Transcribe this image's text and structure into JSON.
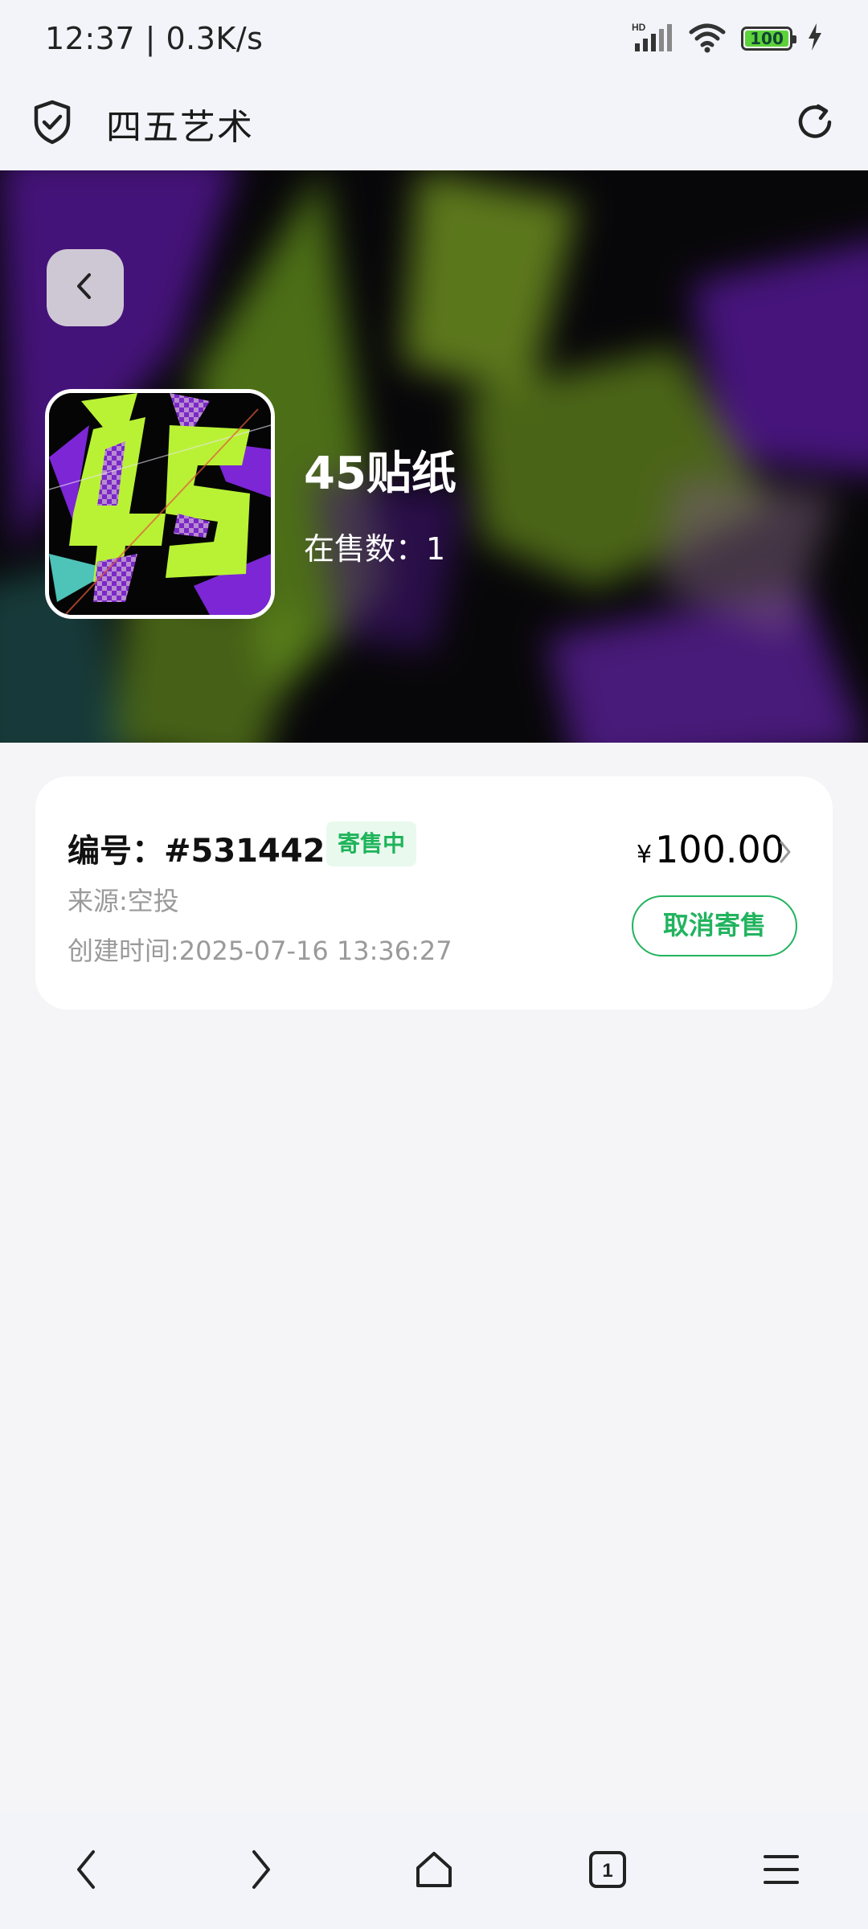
{
  "status_bar": {
    "time": "12:37 | 0.3K/s",
    "network_label": "HD",
    "battery_level": "100",
    "icons": [
      "hd-signal-icon",
      "wifi-icon",
      "battery-icon",
      "charging-icon"
    ]
  },
  "header": {
    "title": "四五艺术",
    "icons": [
      "shield-check-icon",
      "refresh-icon"
    ]
  },
  "hero": {
    "title": "45贴纸",
    "on_sale": "在售数：1",
    "colors": {
      "green": "#a7e22e",
      "purple": "#7a1fd1",
      "black": "#0b0a0d"
    }
  },
  "listing": {
    "id": "编号：#5314426",
    "status": "寄售中",
    "source": "来源:空投",
    "created": "创建时间:2025-07-16 13:36:27",
    "currency": "¥",
    "price": "100.00",
    "cancel_label": "取消寄售",
    "accent": "#22b35e"
  },
  "bottom_nav": {
    "tab_count": "1",
    "icons": [
      "back-icon",
      "forward-icon",
      "home-icon",
      "tabs-icon",
      "menu-icon"
    ]
  }
}
